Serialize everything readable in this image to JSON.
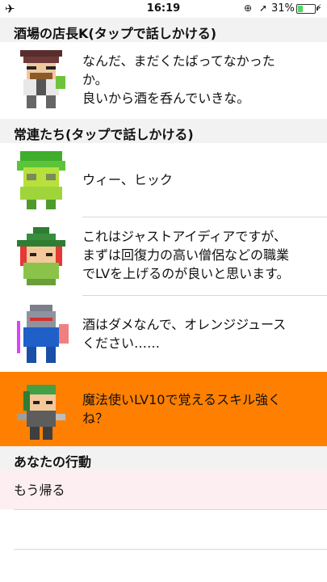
{
  "status_bar": {
    "time": "16:19",
    "battery_percent": "31%",
    "battery_level": 0.31,
    "icons": [
      "airplane-icon",
      "rotation-lock-icon",
      "location-arrow-icon",
      "battery-icon",
      "charging-bolt-icon"
    ]
  },
  "bartender_section": {
    "title": "酒場の店長K(タップで話しかける)"
  },
  "bartender": {
    "line1": "なんだ、まだくたばってなかった",
    "line2": "か。",
    "line3": "良いから酒を呑んでいきな。"
  },
  "regulars_section": {
    "title": "常連たち(タップで話しかける)"
  },
  "regulars": [
    {
      "line1": "ウィー、ヒック",
      "line2": "",
      "line3": ""
    },
    {
      "line1": "これはジャストアイディアですが、",
      "line2": "まずは回復力の高い僧侶などの職業",
      "line3": "でLVを上げるのが良いと思います。"
    },
    {
      "line1": "酒はダメなんで、オレンジジュース",
      "line2": "ください……",
      "line3": ""
    },
    {
      "line1": "魔法使いLV10で覚えるスキル強く",
      "line2": "ね？",
      "line3": ""
    }
  ],
  "actions_section": {
    "title": "あなたの行動"
  },
  "actions": {
    "go_home": "もう帰る"
  },
  "colors": {
    "highlight": "#ff8000",
    "action_bg": "#fdeef1",
    "section_bg": "#f2f2f2"
  }
}
